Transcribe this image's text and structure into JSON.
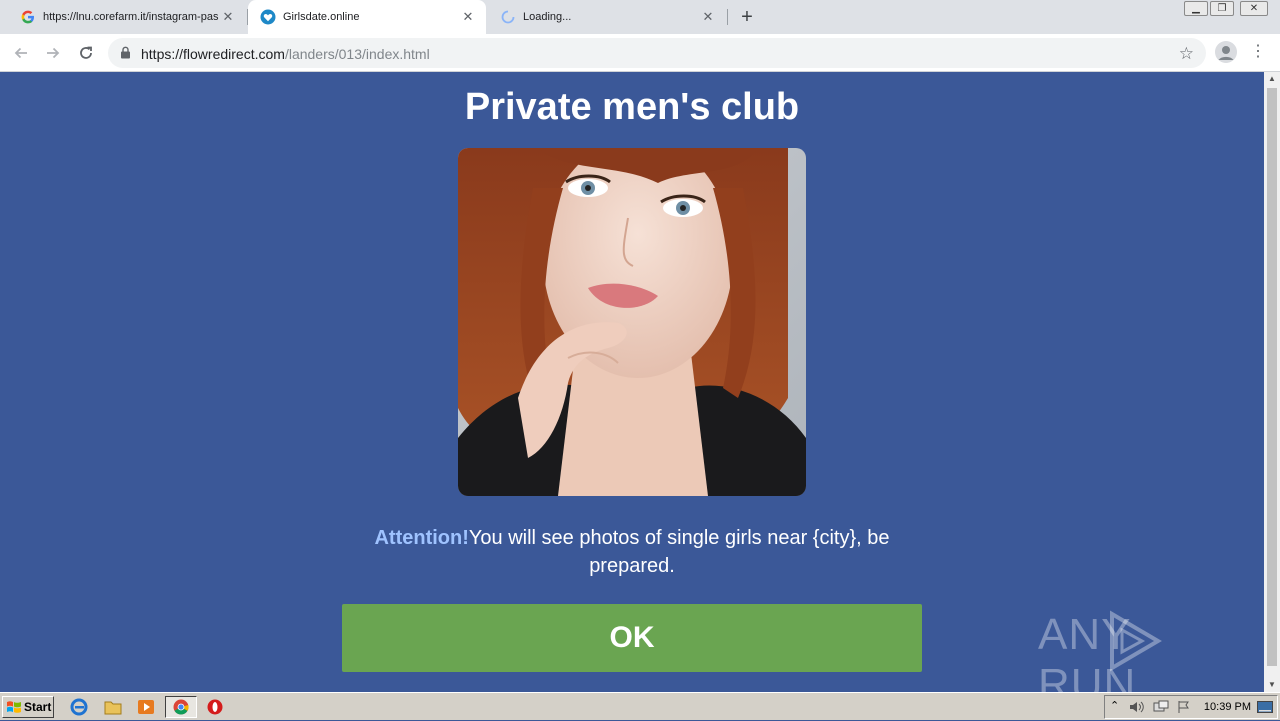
{
  "browser": {
    "tabs": [
      {
        "title": "https://lnu.corefarm.it/instagram-pas",
        "icon": "google-icon"
      },
      {
        "title": "Girlsdate.online",
        "icon": "heart-shield-icon"
      },
      {
        "title": "Loading...",
        "icon": "loading-spinner-icon"
      }
    ],
    "new_tab_label": "+",
    "address": {
      "host": "https://flowredirect.com",
      "path": "/landers/013/index.html"
    }
  },
  "page": {
    "heading": "Private men's club",
    "notice_attention": "Attention!",
    "notice_text": "You will see photos of single girls near {city}, be prepared.",
    "ok_label": "OK",
    "watermark": "ANY RUN"
  },
  "taskbar": {
    "start_label": "Start",
    "clock": "10:39 PM"
  },
  "colors": {
    "page_bg": "#3b5898",
    "ok_button": "#6aa551",
    "attention": "#9fc3ff"
  }
}
